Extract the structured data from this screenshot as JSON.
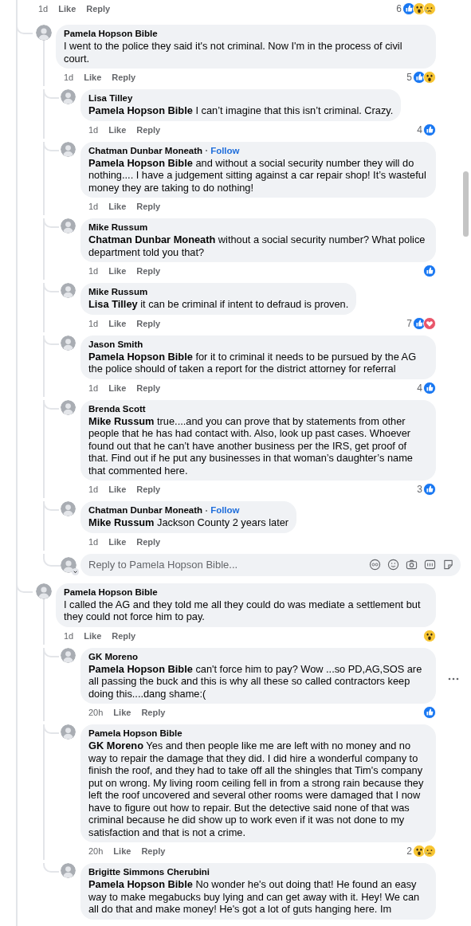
{
  "top_meta": {
    "time": "1d",
    "like": "Like",
    "reply": "Reply",
    "reaction_count": "6",
    "reactions": [
      {
        "kind": "like"
      },
      {
        "kind": "wow"
      },
      {
        "kind": "sad"
      }
    ]
  },
  "comments": [
    {
      "author": "Pamela Hopson Bible",
      "text": "I went to the police they said it's not criminal. Now I'm in the process of civil court.",
      "time": "1d",
      "like": "Like",
      "reply": "Reply",
      "reaction_count": "5",
      "reactions": [
        {
          "kind": "like"
        },
        {
          "kind": "wow"
        }
      ],
      "show_menu": false,
      "children": [
        {
          "author": "Lisa Tilley",
          "text": "**Pamela Hopson Bible** I can’t imagine that this isn’t criminal. Crazy.",
          "time": "1d",
          "like": "Like",
          "reply": "Reply",
          "reaction_count": "4",
          "reactions": [
            {
              "kind": "like"
            }
          ],
          "show_menu": false
        },
        {
          "author": "Chatman Dunbar Moneath",
          "follow": "Follow",
          "text": "**Pamela Hopson Bible** and without a social security number they will do nothing.... I have a judgement sitting against a car repair shop! It’s wasteful money they are taking to do nothing!",
          "time": "1d",
          "like": "Like",
          "reply": "Reply",
          "show_menu": false
        },
        {
          "author": "Mike Russum",
          "text": "**Chatman Dunbar Moneath** without a social security number? What police department told you that?",
          "time": "1d",
          "like": "Like",
          "reply": "Reply",
          "reactions": [
            {
              "kind": "like"
            }
          ],
          "show_menu": false
        },
        {
          "author": "Mike Russum",
          "text": "**Lisa Tilley** it can be criminal if intent to defraud is proven.",
          "time": "1d",
          "like": "Like",
          "reply": "Reply",
          "reaction_count": "7",
          "reactions": [
            {
              "kind": "like"
            },
            {
              "kind": "love"
            }
          ],
          "show_menu": false
        },
        {
          "author": "Jason Smith",
          "text": "**Pamela Hopson Bible** for it to criminal it needs to be pursued by the AG the police should of taken a report for the district attorney for referral",
          "time": "1d",
          "like": "Like",
          "reply": "Reply",
          "reaction_count": "4",
          "reactions": [
            {
              "kind": "like"
            }
          ],
          "show_menu": false
        },
        {
          "author": "Brenda Scott",
          "text": "**Mike Russum** true....and you can prove that by statements from other people that he has had contact with. Also, look up past cases. Whoever found out that he can’t have another business per the IRS, get proof of that. Find out if he put any businesses in that woman’s daughter’s name that commented here.",
          "time": "1d",
          "like": "Like",
          "reply": "Reply",
          "reaction_count": "3",
          "reactions": [
            {
              "kind": "like"
            }
          ],
          "show_menu": false
        },
        {
          "author": "Chatman Dunbar Moneath",
          "follow": "Follow",
          "text": "**Mike Russum** Jackson County 2 years later",
          "time": "1d",
          "like": "Like",
          "reply": "Reply",
          "show_menu": false
        }
      ],
      "reply_box": {
        "placeholder": "Reply to Pamela Hopson Bible..."
      }
    },
    {
      "author": "Pamela Hopson Bible",
      "text": "I called the AG and they told me all they could do was mediate a settlement but they could not force him to pay.",
      "time": "1d",
      "like": "Like",
      "reply": "Reply",
      "reactions": [
        {
          "kind": "wow"
        }
      ],
      "show_menu": false,
      "children": [
        {
          "author": "GK Moreno",
          "text": "**Pamela Hopson Bible** can't force him to pay? Wow ...so PD,AG,SOS are all passing the buck and this is why all these so called contractors keep doing this....dang shame:(",
          "time": "20h",
          "like": "Like",
          "reply": "Reply",
          "reactions": [
            {
              "kind": "like"
            }
          ],
          "show_menu": true
        },
        {
          "author": "Pamela Hopson Bible",
          "text": "**GK Moreno** Yes and then people like me are left with no money and no way to repair the damage that they did. I did hire a wonderful company to finish the roof, and they had to take off all the shingles that Tim's company put on wrong. My living room ceiling fell in from a strong rain because they left the roof uncovered and several other rooms were damaged that I now have to figure out how to repair. But the detective said none of that was criminal because he did show up to work even if it was not done to my satisfaction and that is not a crime.",
          "time": "20h",
          "like": "Like",
          "reply": "Reply",
          "reaction_count": "2",
          "reactions": [
            {
              "kind": "wow"
            },
            {
              "kind": "sad"
            }
          ],
          "show_menu": false
        },
        {
          "author": "Brigitte Simmons Cherubini",
          "text": "**Pamela Hopson Bible** No wonder he's out doing that! He found an easy way to make megabucks buy lying and can get away with it. Hey! We can all do that and make money! He's got a lot of guts hanging here. Im",
          "show_menu": false
        }
      ]
    }
  ]
}
